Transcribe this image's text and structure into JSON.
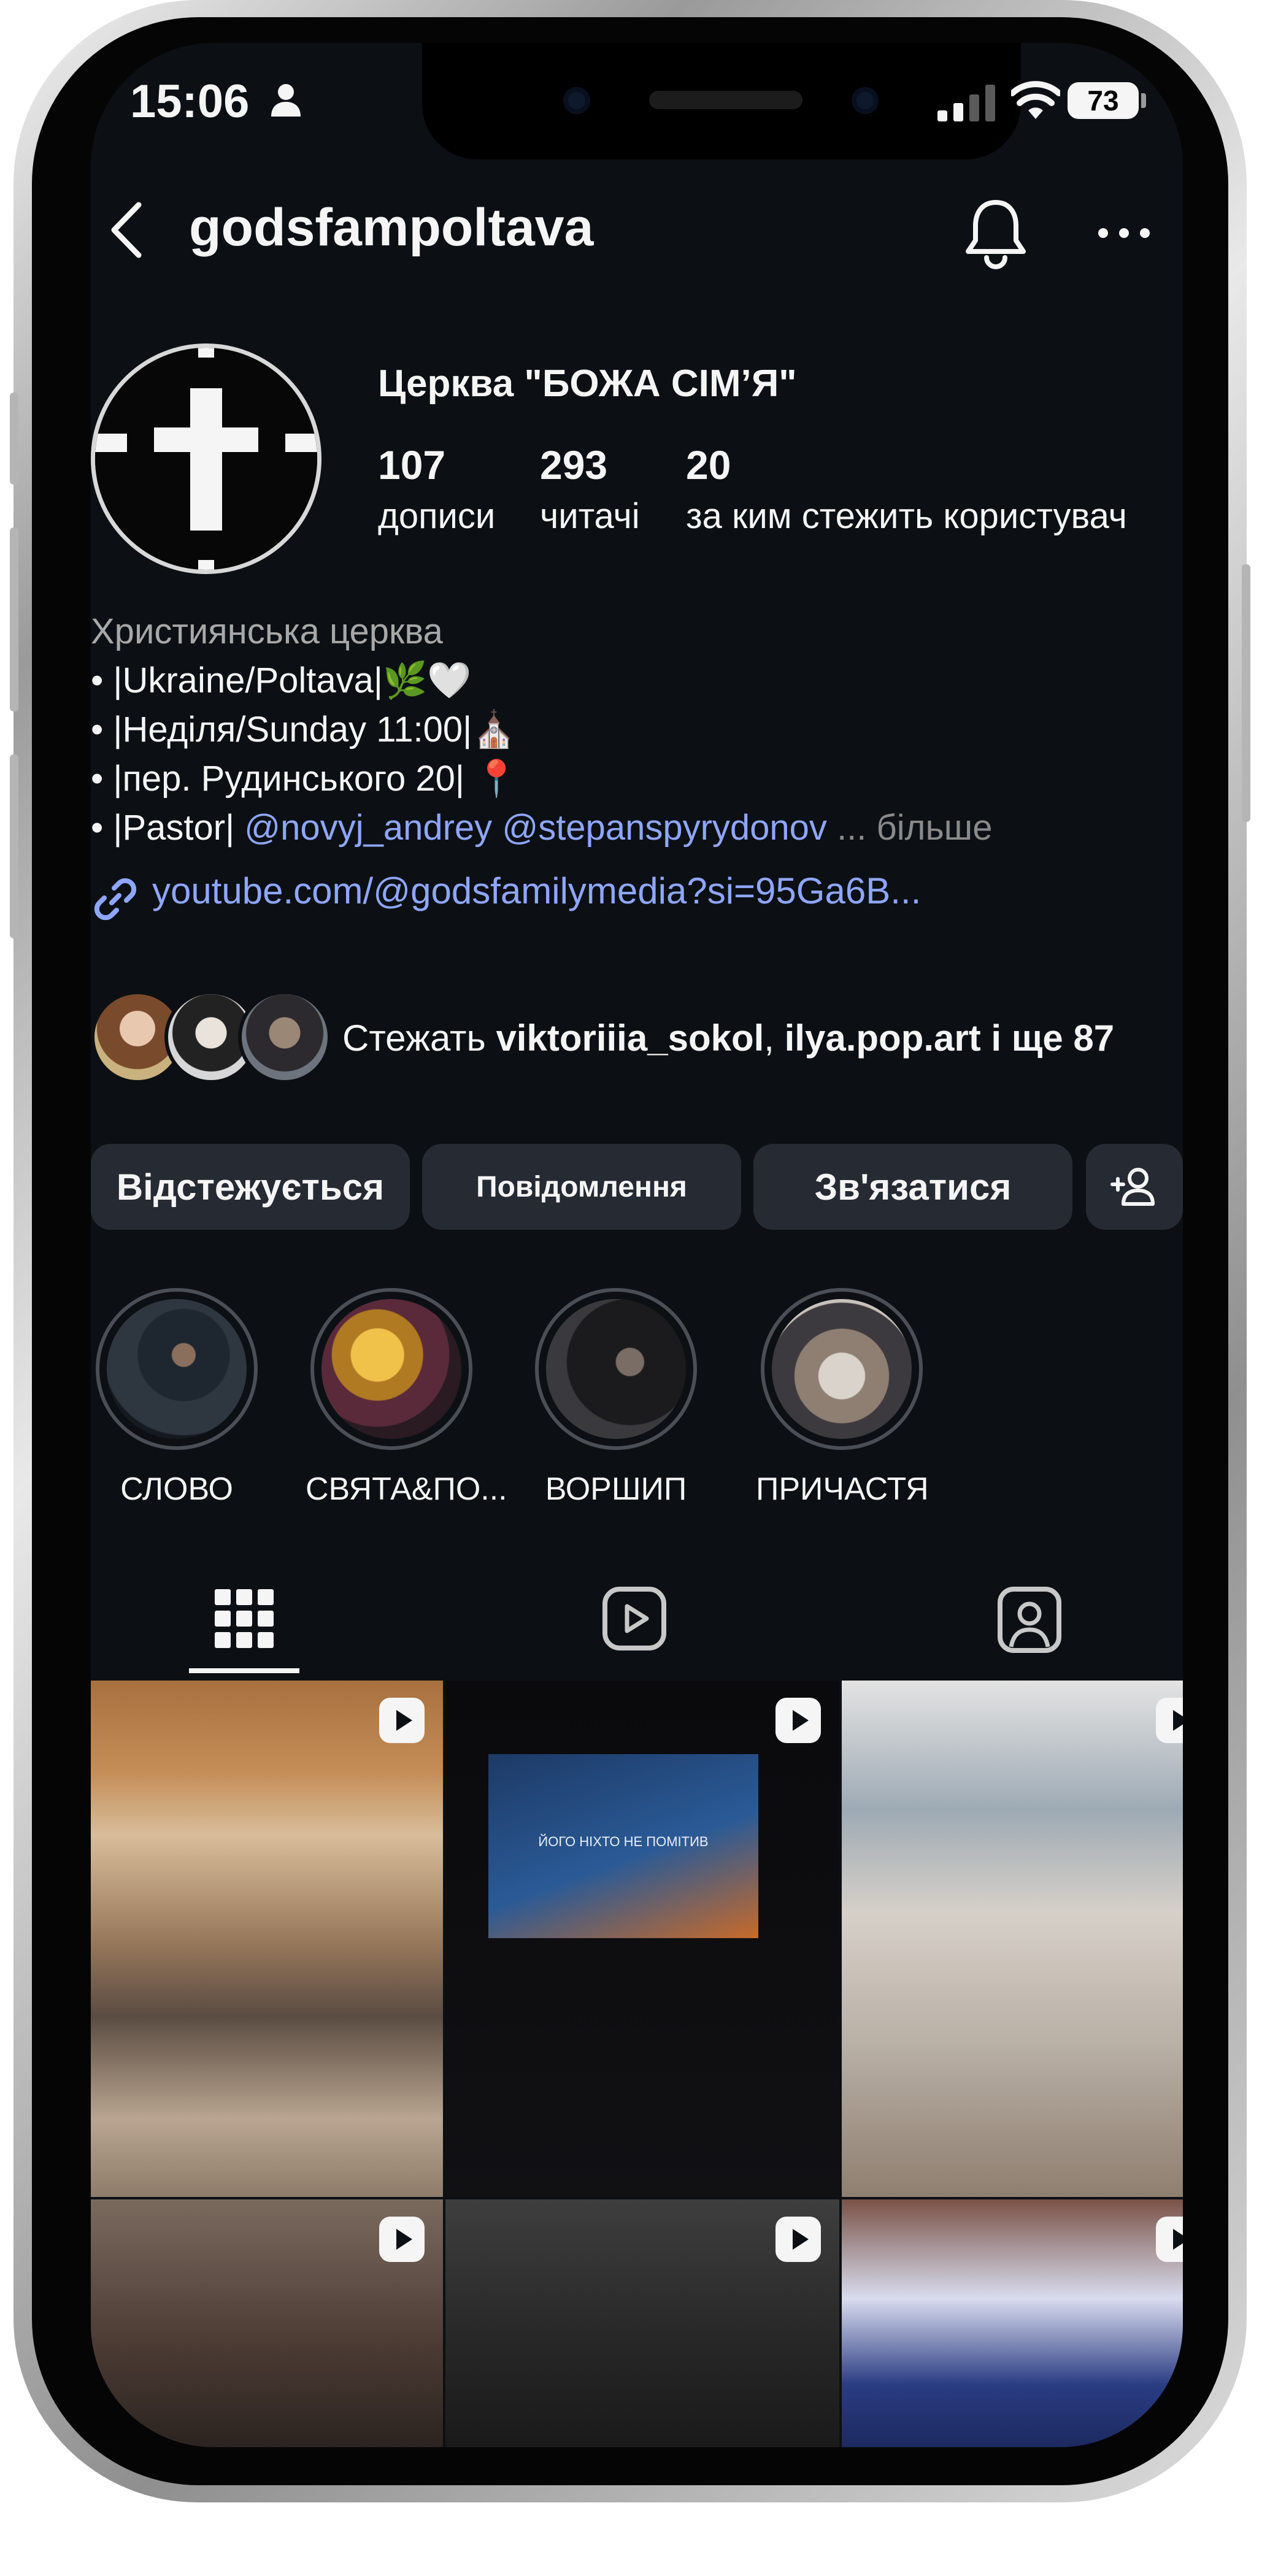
{
  "status_bar": {
    "time": "15:06",
    "battery": "73"
  },
  "header": {
    "username": "godsfampoltava"
  },
  "profile": {
    "display_name": "Церква \"БОЖА СІМ’Я\"",
    "stats": [
      {
        "value": "107",
        "label": "дописи"
      },
      {
        "value": "293",
        "label": "читачі"
      },
      {
        "value": "20",
        "label": "за ким стежить користувач"
      }
    ]
  },
  "bio": {
    "category": "Християнська церква",
    "line1": "• |Ukraine/Poltava|🌿🤍",
    "line2": "• |Неділя/Sunday 11:00|⛪",
    "line3": "• |пер. Рудинського 20| 📍",
    "line4_prefix": "• |Pastor| ",
    "mention1": "@novyj_andrey",
    "mention2": "@stepanspyrydonov",
    "more": "... більше",
    "link": "youtube.com/@godsfamilymedia?si=95Ga6B..."
  },
  "followed_by": {
    "prefix": "Стежать ",
    "user1": "viktoriiia_sokol",
    "sep": ", ",
    "user2": "ilya.pop.art",
    "suffix": " і ще 87"
  },
  "actions": {
    "following": "Відстежується",
    "message": "Повідомлення",
    "contact": "Зв'язатися"
  },
  "highlights": [
    {
      "label": "СЛОВО"
    },
    {
      "label": "СВЯТА&ПО..."
    },
    {
      "label": "ВОРШИП"
    },
    {
      "label": "ПРИЧАСТЯ"
    }
  ],
  "posts": {
    "screen_text": "ЙОГО НІХТО НЕ ПОМІТИВ"
  },
  "colors": {
    "background": "#0c1014",
    "button": "#262a33",
    "link": "#8ea6ff",
    "secondary_text": "#a8a8a8"
  },
  "icons": [
    "back-icon",
    "bell-icon",
    "more-icon",
    "link-icon",
    "add-user-icon",
    "grid-icon",
    "reels-icon",
    "tagged-icon",
    "reel-badge-icon"
  ]
}
